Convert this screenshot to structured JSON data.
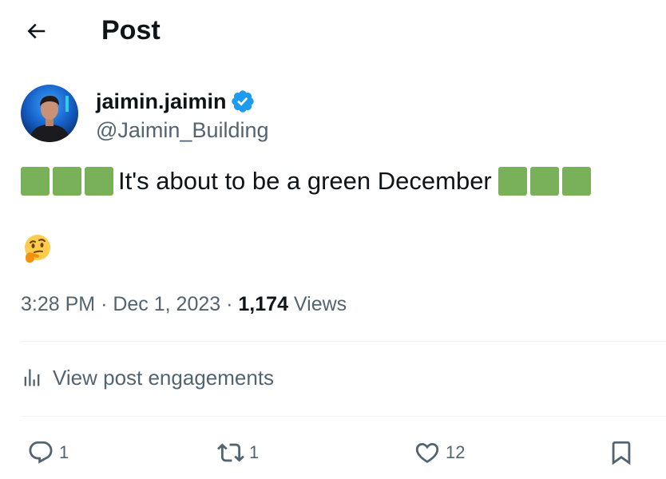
{
  "header": {
    "title": "Post",
    "back_icon": "arrow-left-icon"
  },
  "author": {
    "display_name": "jaimin.jaimin",
    "handle": "@Jaimin_Building",
    "verified_icon": "verified-badge-icon",
    "verified_color": "#1d9bf0"
  },
  "post": {
    "text": "It's about to be a green December",
    "leading_emoji": "green-square-emoji x3",
    "trailing_emoji": "green-square-emoji x3",
    "second_line_emoji": "thinking-face-emoji",
    "square_color": "#78b159"
  },
  "meta": {
    "time": "3:28 PM",
    "date": "Dec 1, 2023",
    "separator": "·",
    "views_count": "1,174",
    "views_label": "Views"
  },
  "engagements": {
    "label": "View post engagements",
    "icon": "bar-chart-icon"
  },
  "actions": {
    "reply_count": "1",
    "retweet_count": "1",
    "like_count": "12",
    "reply_icon": "reply-bubble-icon",
    "retweet_icon": "retweet-icon",
    "like_icon": "heart-icon",
    "bookmark_icon": "bookmark-icon"
  },
  "colors": {
    "text_primary": "#0f1419",
    "text_secondary": "#536471",
    "divider": "#eff3f4"
  }
}
